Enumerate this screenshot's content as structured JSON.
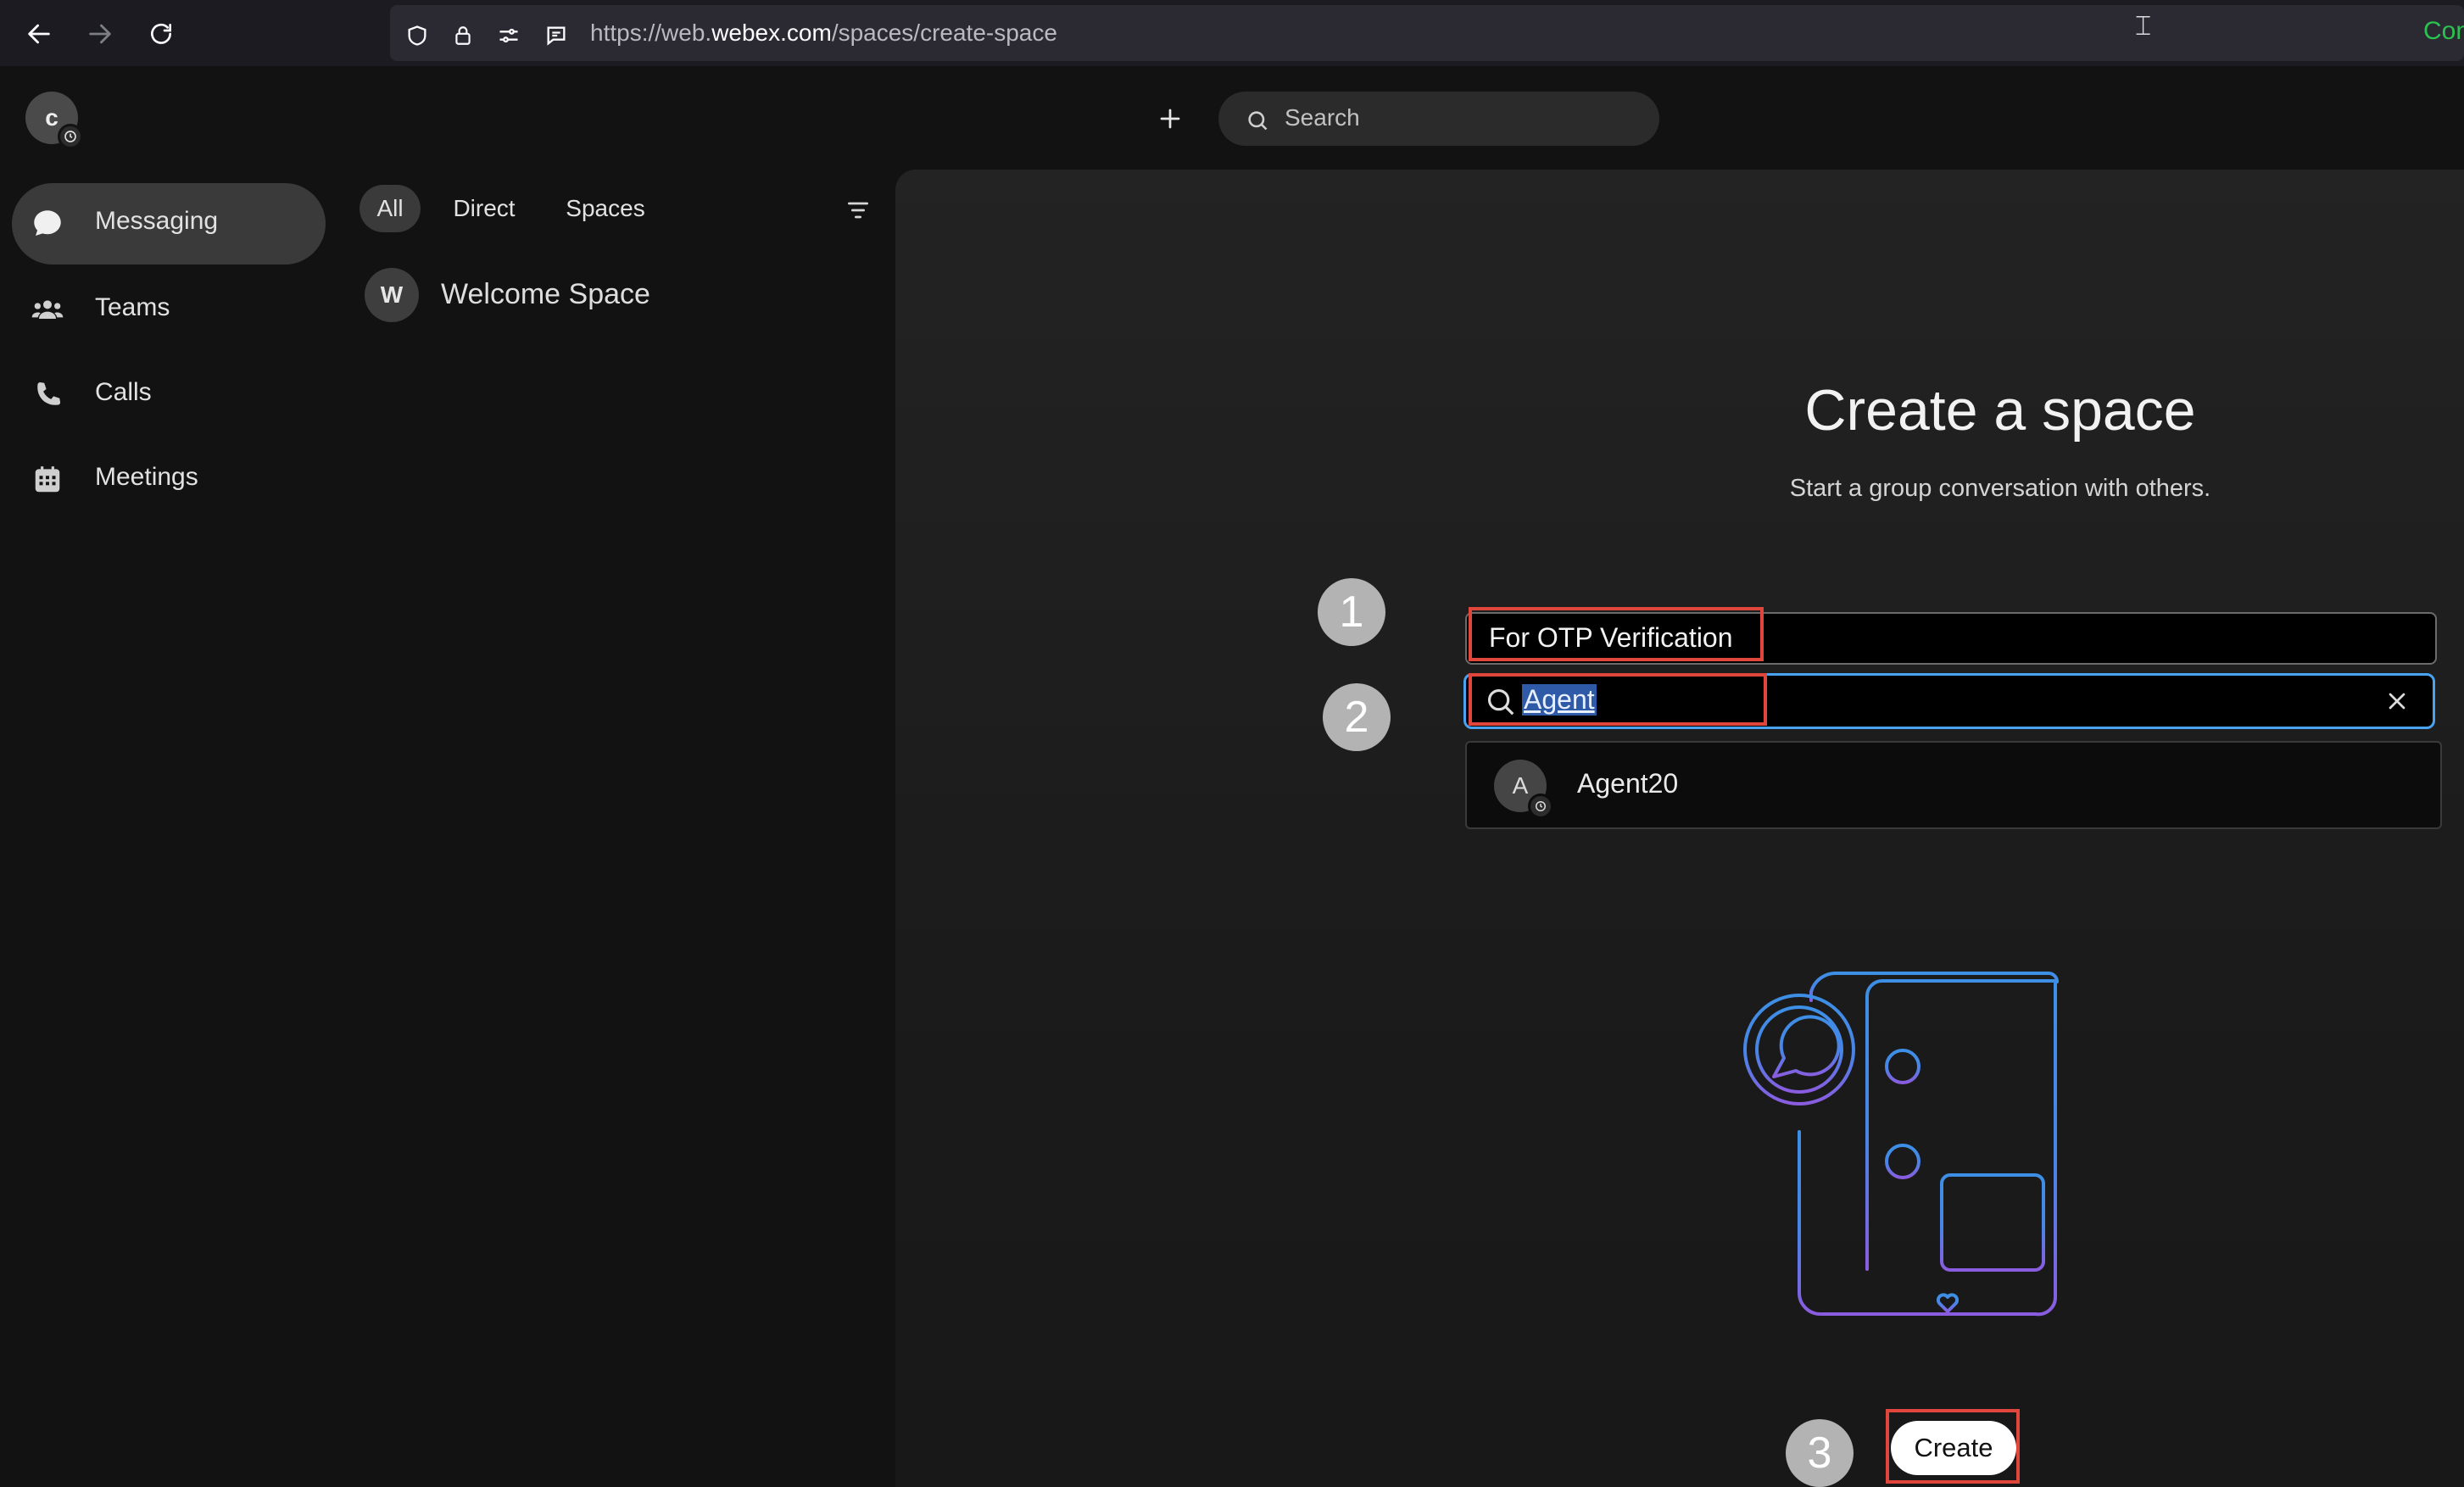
{
  "browser": {
    "url_prefix": "https://web.",
    "url_host": "webex.com",
    "url_path": "/spaces/create-space",
    "right_text": "Con"
  },
  "account": {
    "initial": "c"
  },
  "header": {
    "search_placeholder": "Search"
  },
  "sidebar": {
    "items": [
      {
        "label": "Messaging",
        "icon": "chat-bubble-icon",
        "active": true
      },
      {
        "label": "Teams",
        "icon": "people-icon",
        "active": false
      },
      {
        "label": "Calls",
        "icon": "phone-icon",
        "active": false
      },
      {
        "label": "Meetings",
        "icon": "calendar-icon",
        "active": false
      }
    ]
  },
  "list": {
    "filters": [
      {
        "label": "All",
        "active": true
      },
      {
        "label": "Direct",
        "active": false
      },
      {
        "label": "Spaces",
        "active": false
      }
    ],
    "spaces": [
      {
        "initial": "W",
        "name": "Welcome Space"
      }
    ]
  },
  "create_space": {
    "title": "Create a space",
    "subtitle": "Start a group conversation with others.",
    "space_name_value": "For OTP Verification",
    "people_search_value": "Agent",
    "results": [
      {
        "initial": "A",
        "name": "Agent20"
      }
    ],
    "create_label": "Create"
  },
  "annotations": {
    "step1": "1",
    "step2": "2",
    "step3": "3",
    "highlight_color": "#e0463c"
  },
  "colors": {
    "accent_blue": "#4aa3f0",
    "illustration_blue": "#3d8fe6",
    "illustration_purple": "#8a5ce0"
  }
}
